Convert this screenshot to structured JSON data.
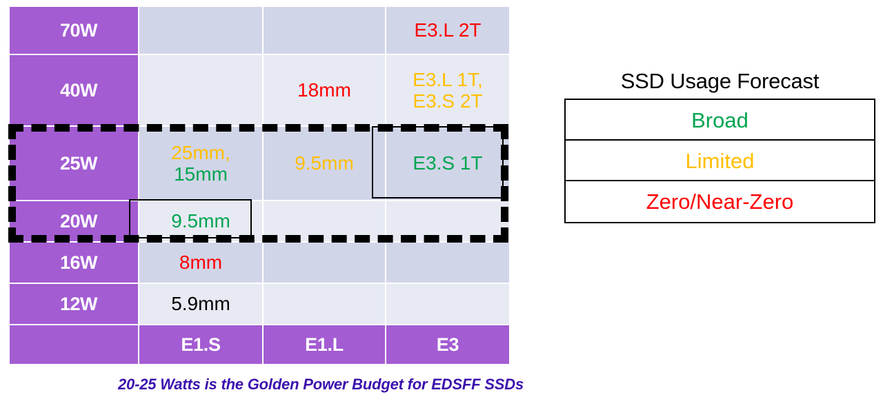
{
  "matrix": {
    "row_labels": [
      "70W",
      "40W",
      "25W",
      "20W",
      "16W",
      "12W"
    ],
    "column_headers": [
      "E1.S",
      "E1.L",
      "E3"
    ],
    "cells": {
      "r70_e1s": "",
      "r70_e1l": "",
      "r70_e3": "E3.L 2T",
      "r40_e1s": "",
      "r40_e1l": "18mm",
      "r40_e3_line1": "E3.L 1T,",
      "r40_e3_line2": "E3.S 2T",
      "r25_e1s_line1": "25mm,",
      "r25_e1s_line2": "15mm",
      "r25_e1l": "9.5mm",
      "r25_e3": "E3.S 1T",
      "r20_e1s": "9.5mm",
      "r20_e1l": "",
      "r20_e3": "",
      "r16_e1s": "8mm",
      "r16_e1l": "",
      "r16_e3": "",
      "r12_e1s": "5.9mm",
      "r12_e1l": "",
      "r12_e3": ""
    }
  },
  "legend": {
    "title": "SSD Usage Forecast",
    "items": [
      {
        "label": "Broad",
        "color": "#00A550"
      },
      {
        "label": "Limited",
        "color": "#FFBF00"
      },
      {
        "label": "Zero/Near-Zero",
        "color": "#FE0000"
      }
    ]
  },
  "caption": {
    "text": "20-25 Watts is the Golden Power Budget for EDSFF SSDs",
    "color": "#3C11AE"
  },
  "colors": {
    "purple_header": "#A35CD2",
    "cell_dark": "#D1D5E8",
    "cell_light": "#E7EAF3",
    "broad_green": "#00A550",
    "limited_amber": "#FFBF00",
    "zero_red": "#FE0000",
    "neutral_black": "#000000",
    "highlight_outline": "#000000"
  }
}
